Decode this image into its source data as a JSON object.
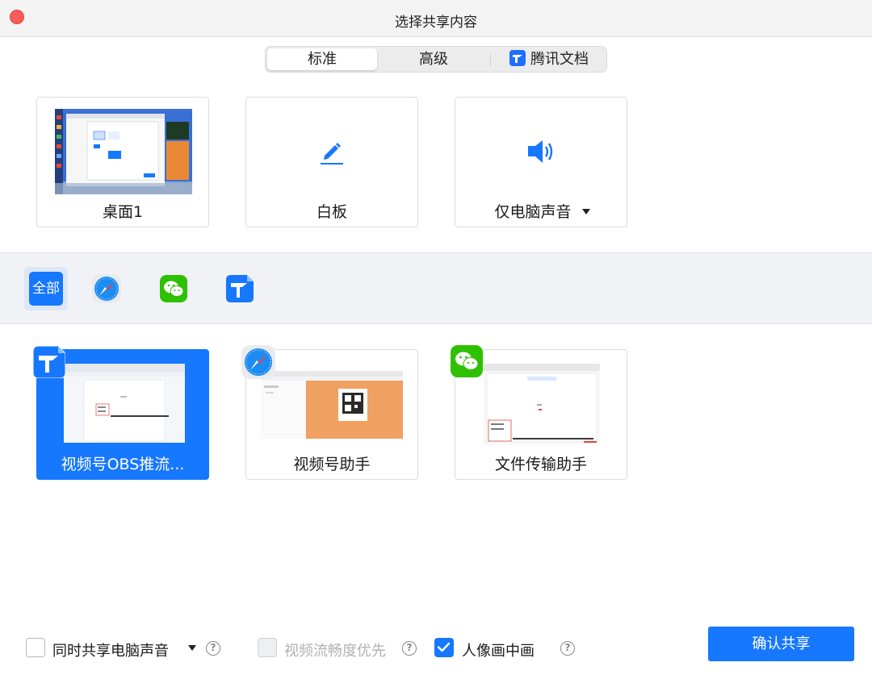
{
  "window": {
    "title": "选择共享内容"
  },
  "tabs": [
    {
      "label": "标准",
      "active": true
    },
    {
      "label": "高级",
      "active": false
    },
    {
      "label": "腾讯文档",
      "active": false,
      "icon": "tencent-docs-icon"
    }
  ],
  "screen_cards": [
    {
      "label": "桌面1",
      "kind": "desktop-thumbnail"
    },
    {
      "label": "白板",
      "icon": "pencil-icon"
    },
    {
      "label": "仅电脑声音",
      "icon": "speaker-icon",
      "has_dropdown": true
    }
  ],
  "filters": [
    {
      "label": "全部",
      "active": true
    },
    {
      "icon": "safari-icon"
    },
    {
      "icon": "wechat-icon"
    },
    {
      "icon": "tencent-docs-icon"
    }
  ],
  "window_cards": [
    {
      "label": "视频号OBS推流...",
      "app_icon": "tencent-docs-icon",
      "selected": true
    },
    {
      "label": "视频号助手",
      "app_icon": "safari-icon",
      "selected": false
    },
    {
      "label": "文件传输助手",
      "app_icon": "wechat-icon",
      "selected": false
    }
  ],
  "footer": {
    "share_audio": {
      "label": "同时共享电脑声音",
      "checked": false
    },
    "smooth_video": {
      "label": "视频流畅度优先",
      "checked": false,
      "disabled": true
    },
    "pip": {
      "label": "人像画中画",
      "checked": true
    },
    "confirm_label": "确认共享",
    "help_glyph": "?"
  },
  "colors": {
    "accent": "#1677ff",
    "close": "#fc5c57",
    "wechat": "#2dc100",
    "panel": "#f1f2f5"
  }
}
